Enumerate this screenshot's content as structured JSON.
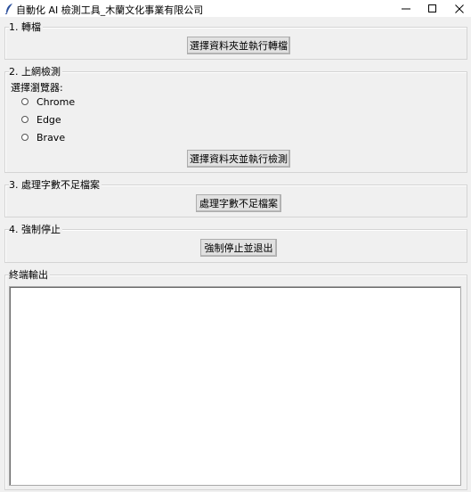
{
  "window": {
    "title": "自動化 AI 檢測工具_木蘭文化事業有限公司",
    "icon": "feather-icon",
    "controls": [
      "minimize-icon",
      "maximize-icon",
      "close-icon"
    ]
  },
  "section_convert": {
    "legend": "1. 轉檔",
    "button_label": "選擇資料夾並執行轉檔"
  },
  "section_detect": {
    "legend": "2. 上網檢測",
    "browser_label": "選擇瀏覽器:",
    "browsers": [
      "Chrome",
      "Edge",
      "Brave"
    ],
    "selected_browser": null,
    "button_label": "選擇資料夾並執行檢測"
  },
  "section_insufficient": {
    "legend": "3. 處理字數不足檔案",
    "button_label": "處理字數不足檔案"
  },
  "section_stop": {
    "legend": "4. 強制停止",
    "button_label": "強制停止並退出"
  },
  "section_output": {
    "legend": "終端輸出",
    "content": ""
  }
}
